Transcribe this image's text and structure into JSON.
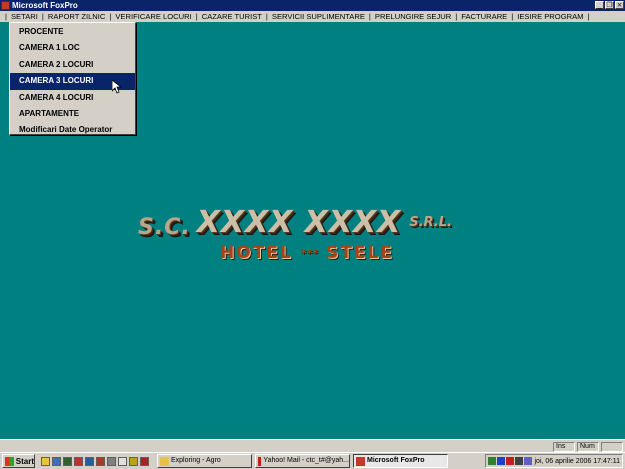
{
  "window": {
    "title": "Microsoft FoxPro"
  },
  "menubar": {
    "items": [
      "SETARI",
      "RAPORT ZILNIC",
      "VERIFICARE LOCURI",
      "CAZARE TURIST",
      "SERVICII SUPLIMENTARE",
      "PRELUNGIRE SEJUR",
      "FACTURARE",
      "IESIRE PROGRAM"
    ],
    "separator": "|"
  },
  "dropdown": {
    "items": [
      "PROCENTE",
      "CAMERA 1 LOC",
      "CAMERA 2 LOCURI",
      "CAMERA 3 LOCURI",
      "CAMERA 4 LOCURI",
      "APARTAMENTE",
      "Modificari Date Operator"
    ],
    "selected_index": 3
  },
  "logo": {
    "prefix": "S.C.",
    "brand": "XXXX XXXX",
    "suffix": "S.R.L.",
    "hotel": "HOTEL",
    "stars": "***",
    "stele": "STELE"
  },
  "statusline": {
    "ins": "Ins",
    "num": "Num"
  },
  "taskbar": {
    "start": "Start",
    "tasks": [
      {
        "label": "Exploring - Agro",
        "active": false
      },
      {
        "label": "Yahoo! Mail - ctc_t#@yah...",
        "active": false
      },
      {
        "label": "Microsoft FoxPro",
        "active": true
      }
    ],
    "clock": "joi, 06 aprilie 2006  17:47:11"
  },
  "colors": {
    "desktop": "#008080",
    "titlebar": "#0a246a",
    "chrome": "#d4d0c8",
    "selection": "#0a246a"
  }
}
